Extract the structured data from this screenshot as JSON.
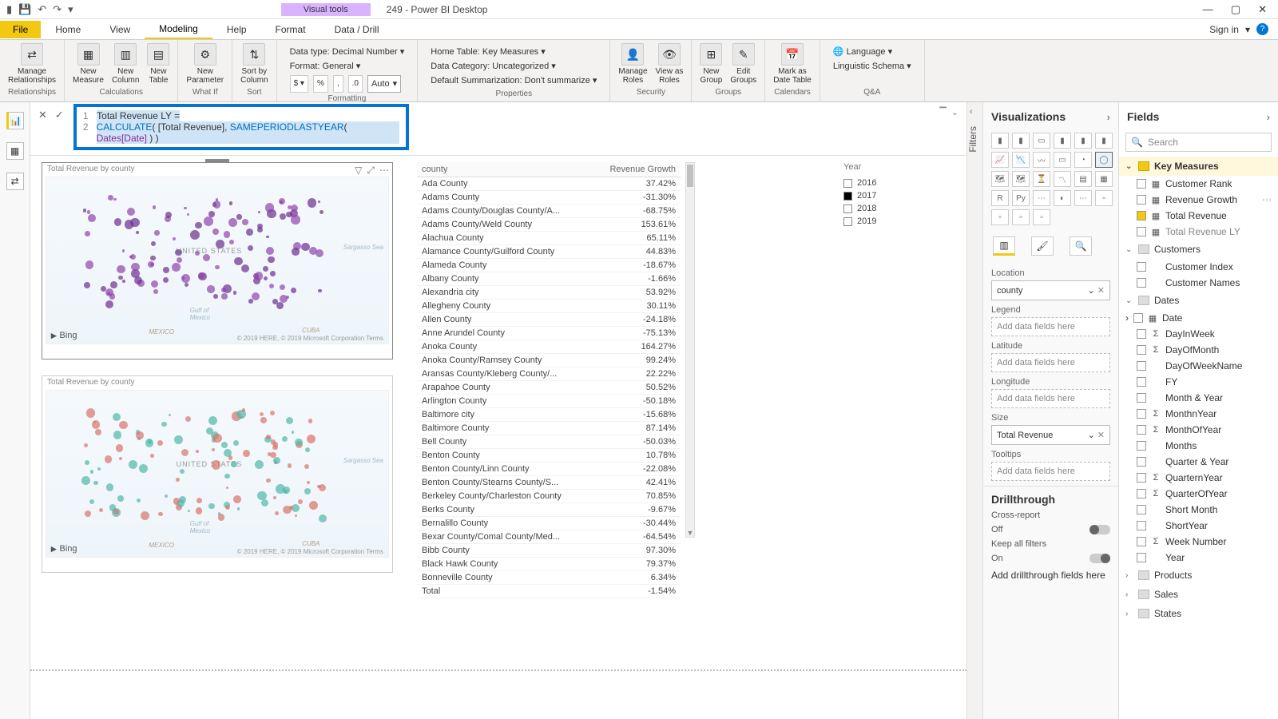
{
  "titlebar": {
    "visual_tools": "Visual tools",
    "title": "249 - Power BI Desktop"
  },
  "tabs": {
    "file": "File",
    "list": [
      "Home",
      "View",
      "Modeling",
      "Help",
      "Format",
      "Data / Drill"
    ],
    "active": "Modeling",
    "signin": "Sign in"
  },
  "ribbon": {
    "calc_group": "Calculations",
    "whatif_group": "What If",
    "sort_group": "Sort",
    "formatting_group": "Formatting",
    "properties_group": "Properties",
    "security_group": "Security",
    "groups_group": "Groups",
    "calendars_group": "Calendars",
    "qa_group": "Q&A",
    "manage_rel": "Manage\nRelationships",
    "new_measure": "New\nMeasure",
    "new_column": "New\nColumn",
    "new_table": "New\nTable",
    "new_param": "New\nParameter",
    "sort_by": "Sort by\nColumn",
    "datatype": "Data type: Decimal Number",
    "format": "Format: General",
    "auto": "Auto",
    "hometable": "Home Table: Key Measures",
    "datacat": "Data Category: Uncategorized",
    "defsum": "Default Summarization: Don't summarize",
    "manage_roles": "Manage\nRoles",
    "view_as": "View as\nRoles",
    "new_group": "New\nGroup",
    "edit_groups": "Edit\nGroups",
    "mark_date": "Mark as\nDate Table",
    "language": "Language",
    "ling": "Linguistic Schema"
  },
  "formula": {
    "line1_name": "Total Revenue LY",
    "line2": "CALCULATE( [Total Revenue], SAMEPERIODLASTYEAR( Dates[Date] ) )"
  },
  "maps": {
    "title1": "Total Revenue by county",
    "title2": "Total Revenue by county",
    "country": "UNITED STATES",
    "cuba": "CUBA",
    "mexico": "MEXICO",
    "gulf": "Gulf of\nMexico",
    "sargasso": "Sargasso Sea",
    "bing": "Bing",
    "credits": "© 2019 HERE, © 2019 Microsoft Corporation Terms"
  },
  "table": {
    "h1": "county",
    "h2": "Revenue Growth",
    "rows": [
      [
        "Ada County",
        "37.42%"
      ],
      [
        "Adams County",
        "-31.30%"
      ],
      [
        "Adams County/Douglas County/A...",
        "-68.75%"
      ],
      [
        "Adams County/Weld County",
        "153.61%"
      ],
      [
        "Alachua County",
        "65.11%"
      ],
      [
        "Alamance County/Guilford County",
        "44.83%"
      ],
      [
        "Alameda County",
        "-18.67%"
      ],
      [
        "Albany County",
        "-1.66%"
      ],
      [
        "Alexandria city",
        "53.92%"
      ],
      [
        "Allegheny County",
        "30.11%"
      ],
      [
        "Allen County",
        "-24.18%"
      ],
      [
        "Anne Arundel County",
        "-75.13%"
      ],
      [
        "Anoka County",
        "164.27%"
      ],
      [
        "Anoka County/Ramsey County",
        "99.24%"
      ],
      [
        "Aransas County/Kleberg County/...",
        "22.22%"
      ],
      [
        "Arapahoe County",
        "50.52%"
      ],
      [
        "Arlington County",
        "-50.18%"
      ],
      [
        "Baltimore city",
        "-15.68%"
      ],
      [
        "Baltimore County",
        "87.14%"
      ],
      [
        "Bell County",
        "-50.03%"
      ],
      [
        "Benton County",
        "10.78%"
      ],
      [
        "Benton County/Linn County",
        "-22.08%"
      ],
      [
        "Benton County/Stearns County/S...",
        "42.41%"
      ],
      [
        "Berkeley County/Charleston County",
        "70.85%"
      ],
      [
        "Berks County",
        "-9.67%"
      ],
      [
        "Bernalillo County",
        "-30.44%"
      ],
      [
        "Bexar County/Comal County/Med...",
        "-64.54%"
      ],
      [
        "Bibb County",
        "97.30%"
      ],
      [
        "Black Hawk County",
        "79.37%"
      ],
      [
        "Bonneville County",
        "6.34%"
      ]
    ],
    "total_label": "Total",
    "total_val": "-1.54%"
  },
  "slicer": {
    "hdr": "Year",
    "opts": [
      [
        "2016",
        false
      ],
      [
        "2017",
        true
      ],
      [
        "2018",
        false
      ],
      [
        "2019",
        false
      ]
    ]
  },
  "filters_label": "Filters",
  "viz": {
    "header": "Visualizations",
    "wells": {
      "location": "Location",
      "legend": "Legend",
      "latitude": "Latitude",
      "longitude": "Longitude",
      "size": "Size",
      "tooltips": "Tooltips"
    },
    "placeholder": "Add data fields here",
    "location_val": "county",
    "size_val": "Total Revenue",
    "drill": {
      "title": "Drillthrough",
      "cross": "Cross-report",
      "off": "Off",
      "keep": "Keep all filters",
      "on": "On",
      "d_placeholder": "Add drillthrough fields here"
    }
  },
  "fields": {
    "header": "Fields",
    "search": "Search",
    "key_measures": {
      "name": "Key Measures",
      "items": [
        {
          "n": "Customer Rank",
          "ico": "▦",
          "c": false
        },
        {
          "n": "Revenue Growth",
          "ico": "▦",
          "c": false,
          "dots": true
        },
        {
          "n": "Total Revenue",
          "ico": "▦",
          "c": true
        },
        {
          "n": "Total Revenue LY",
          "ico": "▦",
          "c": false,
          "sel": true
        }
      ]
    },
    "customers": {
      "name": "Customers",
      "items": [
        {
          "n": "Customer Index",
          "ico": "",
          "c": false
        },
        {
          "n": "Customer Names",
          "ico": "",
          "c": false
        }
      ]
    },
    "dates": {
      "name": "Dates",
      "items": [
        {
          "n": "Date",
          "ico": "▦",
          "c": false,
          "caret": true
        },
        {
          "n": "DayInWeek",
          "ico": "Σ",
          "c": false
        },
        {
          "n": "DayOfMonth",
          "ico": "Σ",
          "c": false
        },
        {
          "n": "DayOfWeekName",
          "ico": "",
          "c": false
        },
        {
          "n": "FY",
          "ico": "",
          "c": false
        },
        {
          "n": "Month & Year",
          "ico": "",
          "c": false
        },
        {
          "n": "MonthnYear",
          "ico": "Σ",
          "c": false
        },
        {
          "n": "MonthOfYear",
          "ico": "Σ",
          "c": false
        },
        {
          "n": "Months",
          "ico": "",
          "c": false
        },
        {
          "n": "Quarter & Year",
          "ico": "",
          "c": false
        },
        {
          "n": "QuarternYear",
          "ico": "Σ",
          "c": false
        },
        {
          "n": "QuarterOfYear",
          "ico": "Σ",
          "c": false
        },
        {
          "n": "Short Month",
          "ico": "",
          "c": false
        },
        {
          "n": "ShortYear",
          "ico": "",
          "c": false
        },
        {
          "n": "Week Number",
          "ico": "Σ",
          "c": false
        },
        {
          "n": "Year",
          "ico": "",
          "c": false
        }
      ]
    },
    "products": {
      "name": "Products"
    },
    "sales": {
      "name": "Sales"
    },
    "states": {
      "name": "States"
    }
  }
}
